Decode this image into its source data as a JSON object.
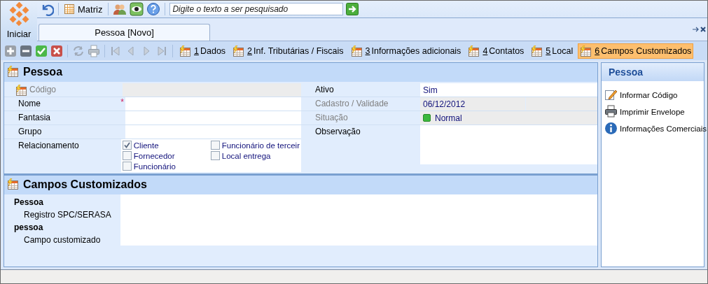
{
  "app": {
    "start_button": "Iniciar",
    "matrix_button": "Matriz",
    "search": {
      "placeholder": "Digite o texto a ser pesquisado"
    }
  },
  "document_tabs": [
    {
      "label": "Pessoa [Novo]",
      "selected": true
    }
  ],
  "record_toolbar": [
    {
      "kind": "add"
    },
    {
      "kind": "remove"
    },
    {
      "kind": "confirm"
    },
    {
      "kind": "cancel"
    },
    {
      "kind": "sep"
    },
    {
      "kind": "refresh"
    },
    {
      "kind": "print"
    },
    {
      "kind": "sep"
    },
    {
      "kind": "first"
    },
    {
      "kind": "prev"
    },
    {
      "kind": "next"
    },
    {
      "kind": "last"
    },
    {
      "kind": "sep"
    }
  ],
  "section_tabs": [
    {
      "key": "1",
      "label": "Dados",
      "selected": false
    },
    {
      "key": "2",
      "label": "Inf. Tributárias / Fiscais",
      "selected": false
    },
    {
      "key": "3",
      "label": "Informações adicionais",
      "selected": false
    },
    {
      "key": "4",
      "label": "Contatos",
      "selected": false
    },
    {
      "key": "5",
      "label": "Local",
      "selected": false
    },
    {
      "key": "6",
      "label": "Campos Customizados",
      "selected": true
    }
  ],
  "form": {
    "title": "Pessoa",
    "left_fields": [
      {
        "kind": "code",
        "label": "Código",
        "disabled": true
      },
      {
        "kind": "text",
        "label": "Nome",
        "required_mark": "*",
        "disabled": false
      },
      {
        "kind": "text",
        "label": "Fantasia",
        "disabled": false
      },
      {
        "kind": "text",
        "label": "Grupo",
        "disabled": false
      },
      {
        "kind": "checks",
        "label": "Relacionamento",
        "disabled": false,
        "options": [
          {
            "label": "Cliente",
            "checked": true
          },
          {
            "label": "Funcionário de terceir",
            "checked": false
          },
          {
            "label": "Fornecedor",
            "checked": false
          },
          {
            "label": "Local entrega",
            "checked": false
          },
          {
            "label": "Funcionário",
            "checked": false
          }
        ]
      }
    ],
    "right_fields": [
      {
        "kind": "text",
        "label": "Ativo",
        "value": "Sim",
        "disabled": false
      },
      {
        "kind": "split",
        "label": "Cadastro / Validade",
        "value": "06/12/2012",
        "disabled": true
      },
      {
        "kind": "status",
        "label": "Situação",
        "value": "Normal",
        "color": "#3cb83c",
        "disabled": true
      },
      {
        "kind": "memo",
        "label": "Observação",
        "disabled": false
      }
    ]
  },
  "custom_fields": {
    "title": "Campos Customizados",
    "groups": [
      {
        "name": "Pessoa",
        "fields": [
          "Registro SPC/SERASA"
        ]
      },
      {
        "name": "pessoa",
        "fields": [
          "Campo customizado"
        ]
      }
    ]
  },
  "side_panel": {
    "title": "Pessoa",
    "links": [
      {
        "kind": "edit",
        "label": "Informar Código"
      },
      {
        "kind": "print",
        "label": "Imprimir Envelope"
      },
      {
        "kind": "info",
        "label": "Informações Comerciais"
      }
    ]
  }
}
